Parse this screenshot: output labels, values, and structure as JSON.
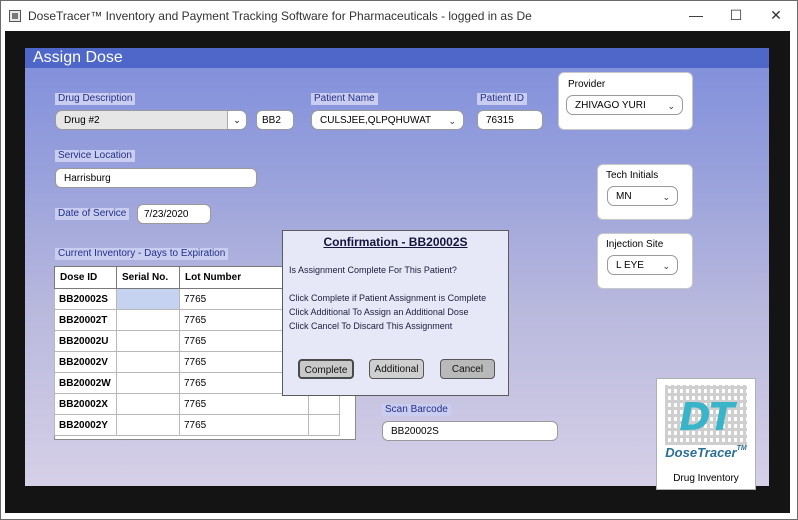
{
  "window": {
    "title": "DoseTracer™ Inventory and Payment Tracking Software for Pharmaceuticals - logged in as De",
    "minimize": "—",
    "maximize": "☐",
    "close": "✕"
  },
  "section": {
    "title": "Assign  Dose"
  },
  "drug": {
    "label": "Drug Description",
    "value": "Drug #2",
    "code": "BB2"
  },
  "patient": {
    "name_label": "Patient Name",
    "name": "CULSJEE,QLPQHUWAT",
    "id_label": "Patient ID",
    "id": "76315"
  },
  "provider": {
    "label": "Provider",
    "value": "ZHIVAGO YURI"
  },
  "service_location": {
    "label": "Service Location",
    "value": "Harrisburg"
  },
  "date_of_service": {
    "label": "Date of Service",
    "value": "7/23/2020"
  },
  "tech_initials": {
    "label": "Tech Initials",
    "value": "MN"
  },
  "injection_site": {
    "label": "Injection Site",
    "value": "L EYE"
  },
  "inventory": {
    "label": "Current Inventory - Days to Expiration",
    "columns": [
      "Dose ID",
      "Serial No.",
      "Lot Number"
    ],
    "rows": [
      {
        "dose_id": "BB20002S",
        "serial": "",
        "lot": "7765"
      },
      {
        "dose_id": "BB20002T",
        "serial": "",
        "lot": "7765"
      },
      {
        "dose_id": "BB20002U",
        "serial": "",
        "lot": "7765"
      },
      {
        "dose_id": "BB20002V",
        "serial": "",
        "lot": "7765"
      },
      {
        "dose_id": "BB20002W",
        "serial": "",
        "lot": "7765"
      },
      {
        "dose_id": "BB20002X",
        "serial": "",
        "lot": "7765"
      },
      {
        "dose_id": "BB20002Y",
        "serial": "",
        "lot": "7765"
      }
    ]
  },
  "scan_barcode": {
    "label": "Scan Barcode",
    "value": "BB20002S"
  },
  "dialog": {
    "title": "Confirmation - BB20002S",
    "question": "Is Assignment Complete For This Patient?",
    "line1": "Click Complete if Patient Assignment is Complete",
    "line2": "Click Additional To Assign an Additional Dose",
    "line3": "Click Cancel To Discard This Assignment",
    "complete": "Complete",
    "additional": "Additional",
    "cancel": "Cancel"
  },
  "logo": {
    "letters": "DT",
    "name": "DoseTracer",
    "tm": "TM",
    "subtitle": "Drug Inventory"
  },
  "colors": {
    "header_bar": "#4e67c8",
    "selected_cell": "#c6d3f0",
    "dialog_bg": "#e6e8f7"
  }
}
